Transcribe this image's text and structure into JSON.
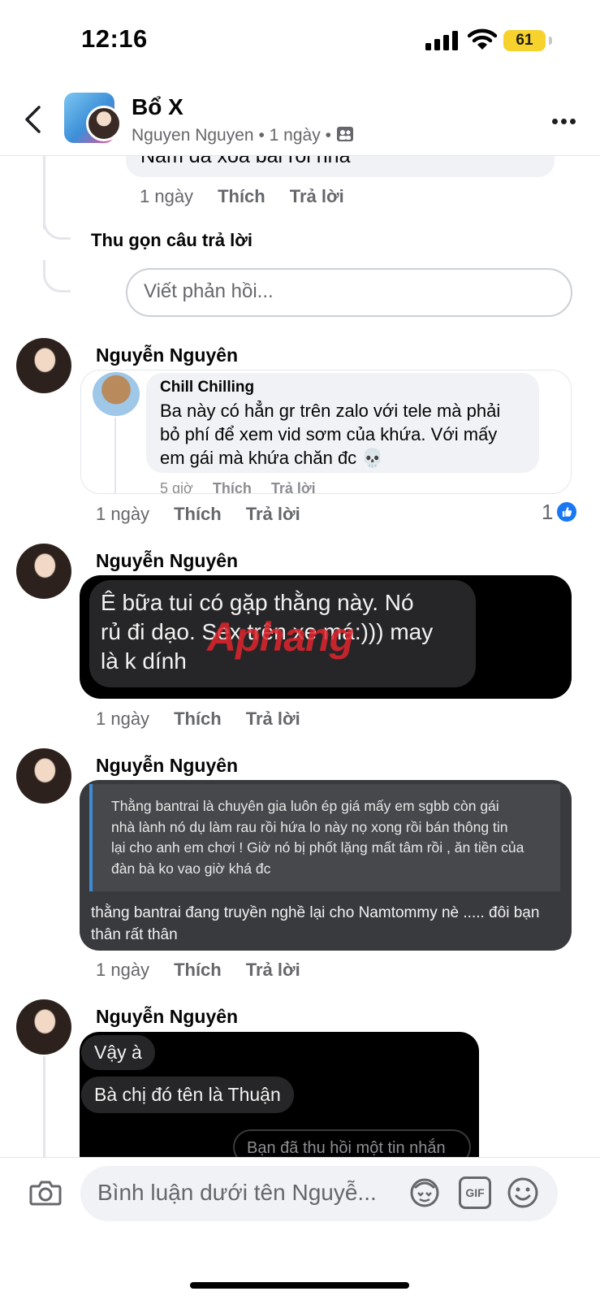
{
  "status_bar": {
    "time": "12:16",
    "battery": "61"
  },
  "header": {
    "title": "Bổ X",
    "author": "Nguyen Nguyen",
    "dot1": "•",
    "age": "1 ngày",
    "dot2": "•"
  },
  "previous_reply": {
    "text": "Nam đã xóa bài rồi nha",
    "time": "1 ngày",
    "like": "Thích",
    "reply": "Trả lời"
  },
  "collapse_label": "Thu gọn câu trả lời",
  "reply_placeholder": "Viết phản hồi...",
  "comments": [
    {
      "name": "Nguyễn Nguyên",
      "quoted": {
        "name": "Chill Chilling",
        "text_lines": [
          "Ba này có hẳn gr trên zalo với tele mà phải",
          "bỏ phí để xem vid sơm của khứa. Với mấy",
          "em gái mà khứa chăn đc 💀"
        ],
        "time": "5 giờ",
        "like": "Thích",
        "reply": "Trả lời"
      },
      "time": "1 ngày",
      "like": "Thích",
      "reply": "Trả lời",
      "like_count": "1"
    },
    {
      "name": "Nguyễn Nguyên",
      "image_text_lines": [
        "Ê bữa tui có gặp thằng này. Nó",
        "rủ đi dạo. Sex trên xe má:))) may",
        "là k dính"
      ],
      "watermark": "Aphang",
      "time": "1 ngày",
      "like": "Thích",
      "reply": "Trả lời"
    },
    {
      "name": "Nguyễn Nguyên",
      "quote_lines": [
        "Thằng bantrai là chuyên gia luôn ép giá mấy em sgbb còn gái",
        "nhà lành nó dụ làm rau rồi hứa lo này nọ xong rồi bán thông tin",
        "lại cho anh em chơi ! Giờ nó bị phốt lặng mất tâm rồi , ăn tiền của",
        "đàn bà ko vao giờ khá đc"
      ],
      "body_lines": [
        "thằng bantrai đang truyền nghề lại cho Namtommy nè ..... đôi bạn",
        "thân rất thân"
      ],
      "time": "1 ngày",
      "like": "Thích",
      "reply": "Trả lời"
    },
    {
      "name": "Nguyễn Nguyên",
      "chat": [
        "Vậy à",
        "Bà chị đó tên là Thuận",
        "Bạn đã thu hồi một tin nhắn"
      ]
    }
  ],
  "composer": {
    "placeholder": "Bình luận dưới tên Nguyễ...",
    "gif": "GIF"
  },
  "colors": {
    "like_blue": "#1877f2",
    "secondary_text": "#65676b",
    "battery": "#f7d22c"
  }
}
